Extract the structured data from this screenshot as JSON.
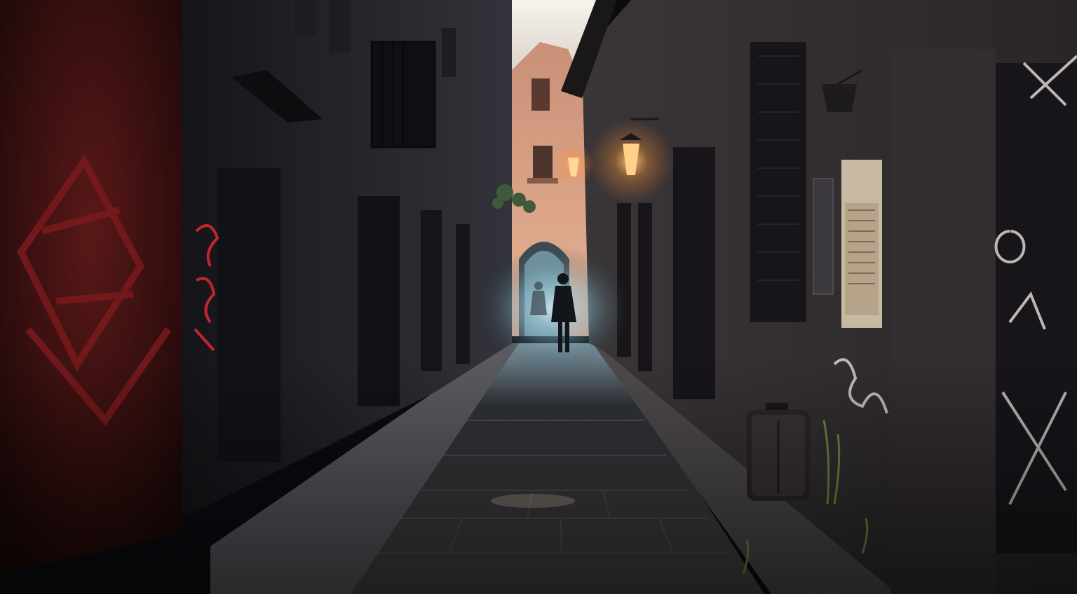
{
  "scene": {
    "subject": "dark-cobblestone-alley",
    "colors": {
      "sky": "#f2ede6",
      "far-building": "#d9a58a",
      "left-wall": "#2b2b33",
      "right-wall": "#2e2c30",
      "red-wall": "#4a1414",
      "road": "#3a3a3e",
      "lamp-glow": "#ffb766",
      "mist": "#9fc8d8",
      "graffiti-red": "#c2262a",
      "graffiti-white": "#d8d4cc"
    }
  }
}
